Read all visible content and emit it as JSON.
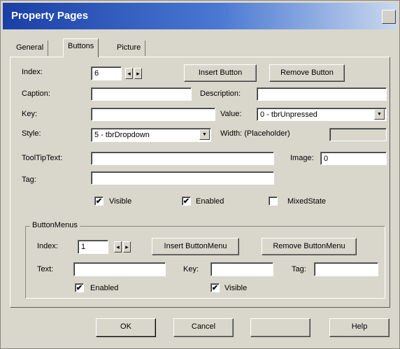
{
  "window": {
    "title": "Property Pages"
  },
  "tabs": [
    {
      "label": "General"
    },
    {
      "label": "Buttons"
    },
    {
      "label": "Picture"
    }
  ],
  "form": {
    "index_label": "Index:",
    "index_value": "6",
    "insert_button": "Insert Button",
    "remove_button": "Remove Button",
    "caption_label": "Caption:",
    "caption_value": "",
    "description_label": "Description:",
    "description_value": "",
    "key_label": "Key:",
    "key_value": "",
    "value_label": "Value:",
    "value_selected": "0 - tbrUnpressed",
    "style_label": "Style:",
    "style_selected": "5 - tbrDropdown",
    "width_label": "Width: (Placeholder)",
    "width_value": "",
    "tooltip_label": "ToolTipText:",
    "tooltip_value": "",
    "image_label": "Image:",
    "image_value": "0",
    "tag_label": "Tag:",
    "tag_value": "",
    "visible_label": "Visible",
    "visible_checked": true,
    "enabled_label": "Enabled",
    "enabled_checked": true,
    "mixedstate_label": "MixedState",
    "mixedstate_checked": false
  },
  "buttonmenu": {
    "group_title": "ButtonMenus",
    "index_label": "Index:",
    "index_value": "1",
    "insert_button": "Insert ButtonMenu",
    "remove_button": "Remove ButtonMenu",
    "text_label": "Text:",
    "text_value": "",
    "key_label": "Key:",
    "key_value": "",
    "tag_label": "Tag:",
    "tag_value": "",
    "enabled_label": "Enabled",
    "enabled_checked": true,
    "visible_label": "Visible",
    "visible_checked": true
  },
  "footer": {
    "ok_label": "OK",
    "cancel_label": "Cancel",
    "apply_label": "",
    "help_label": "Help"
  },
  "glyphs": {
    "check": "✔",
    "arrow_down": "▼",
    "spin_left": "◂",
    "spin_right": "▸"
  }
}
